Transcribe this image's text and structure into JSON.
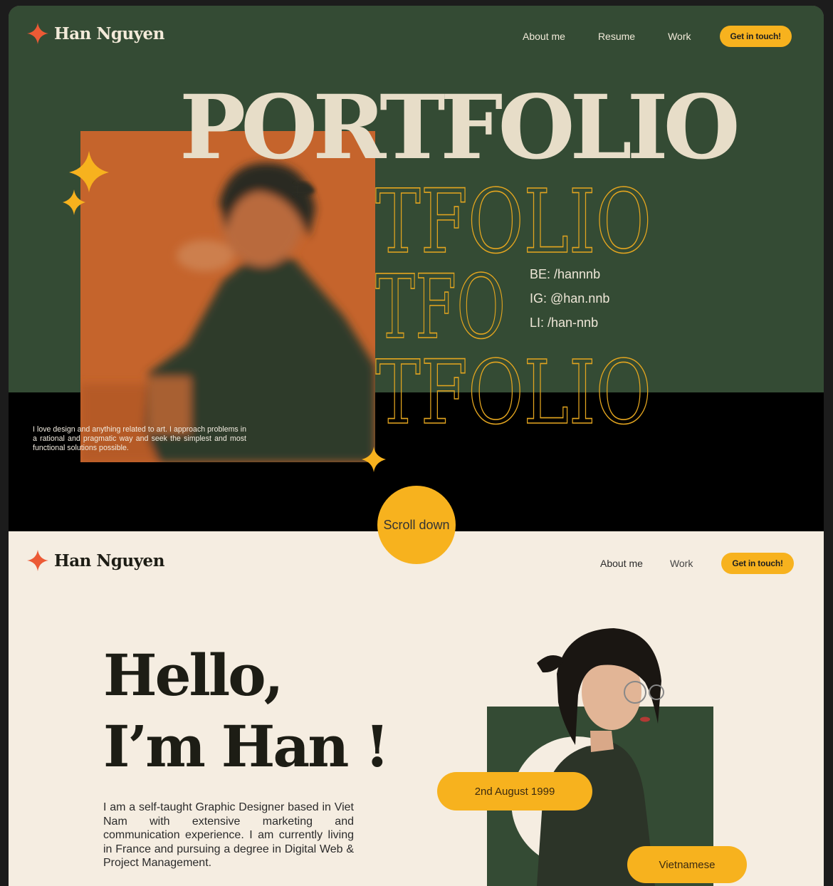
{
  "hero": {
    "brand": "Han Nguyen",
    "nav": [
      "About me",
      "Resume",
      "Work"
    ],
    "cta": "Get in touch!",
    "title": "PORTFOLIO",
    "outline_lines": [
      "TFOLIO",
      "TFO",
      "TFOLIO"
    ],
    "socials": [
      "BE: /hannnb",
      "IG: @han.nnb",
      "LI: /han-nnb"
    ],
    "blurb": "I love design and anything related to art. I approach problems in a rational and pragmatic way and seek the simplest and most functional solutions possible.",
    "scroll": "Scroll down"
  },
  "about": {
    "brand": "Han Nguyen",
    "nav": [
      "About me",
      "Work"
    ],
    "cta": "Get in touch!",
    "greeting_line1": "Hello,",
    "greeting_line2": "I’m Han !",
    "intro": "I am a self-taught Graphic Designer based in Viet Nam with extensive marketing and communication experience. I am currently living in France and pursuing a degree in Digital Web & Project Management.",
    "birthday": "2nd August 1999",
    "nationality": "Vietnamese"
  },
  "colors": {
    "green": "#344b34",
    "orange_block": "#c5642c",
    "accent_yellow": "#f7b21e",
    "logo_star": "#ec5a35",
    "cream": "#f5ede1"
  }
}
